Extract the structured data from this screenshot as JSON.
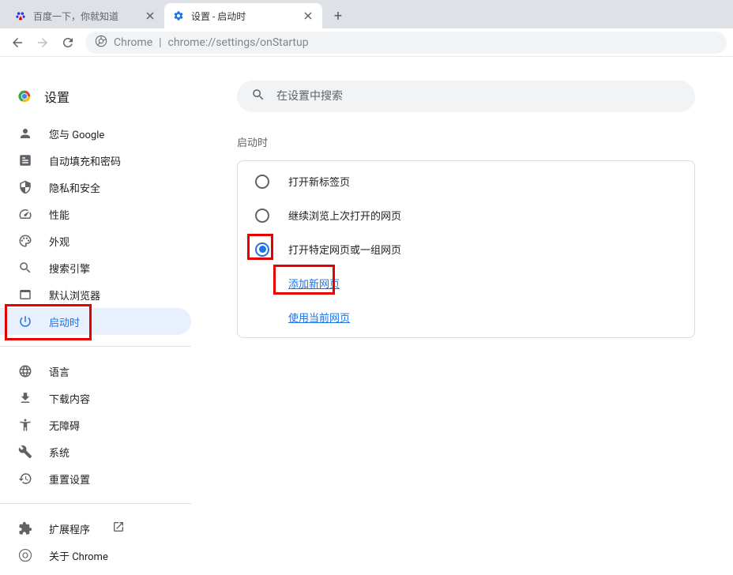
{
  "tabs": [
    {
      "title": "百度一下，你就知道",
      "icon": "baidu"
    },
    {
      "title": "设置 - 启动时",
      "icon": "gear",
      "active": true
    }
  ],
  "url": {
    "prefix": "Chrome",
    "separator": " | ",
    "path": "chrome://settings/onStartup"
  },
  "settings_title": "设置",
  "search_placeholder": "在设置中搜索",
  "sidebar": {
    "items": [
      {
        "icon": "person",
        "label": "您与 Google"
      },
      {
        "icon": "autofill",
        "label": "自动填充和密码"
      },
      {
        "icon": "shield",
        "label": "隐私和安全"
      },
      {
        "icon": "speed",
        "label": "性能"
      },
      {
        "icon": "appearance",
        "label": "外观"
      },
      {
        "icon": "search",
        "label": "搜索引擎"
      },
      {
        "icon": "browser",
        "label": "默认浏览器"
      },
      {
        "icon": "power",
        "label": "启动时",
        "selected": true
      }
    ],
    "items2": [
      {
        "icon": "globe",
        "label": "语言"
      },
      {
        "icon": "download",
        "label": "下载内容"
      },
      {
        "icon": "accessibility",
        "label": "无障碍"
      },
      {
        "icon": "wrench",
        "label": "系统"
      },
      {
        "icon": "reset",
        "label": "重置设置"
      }
    ],
    "items3": [
      {
        "icon": "extension",
        "label": "扩展程序",
        "external": true
      },
      {
        "icon": "chrome",
        "label": "关于 Chrome"
      }
    ]
  },
  "main": {
    "section_title": "启动时",
    "options": [
      {
        "label": "打开新标签页",
        "checked": false
      },
      {
        "label": "继续浏览上次打开的网页",
        "checked": false
      },
      {
        "label": "打开特定网页或一组网页",
        "checked": true
      }
    ],
    "sub_links": [
      {
        "label": "添加新网页"
      },
      {
        "label": "使用当前网页"
      }
    ]
  }
}
